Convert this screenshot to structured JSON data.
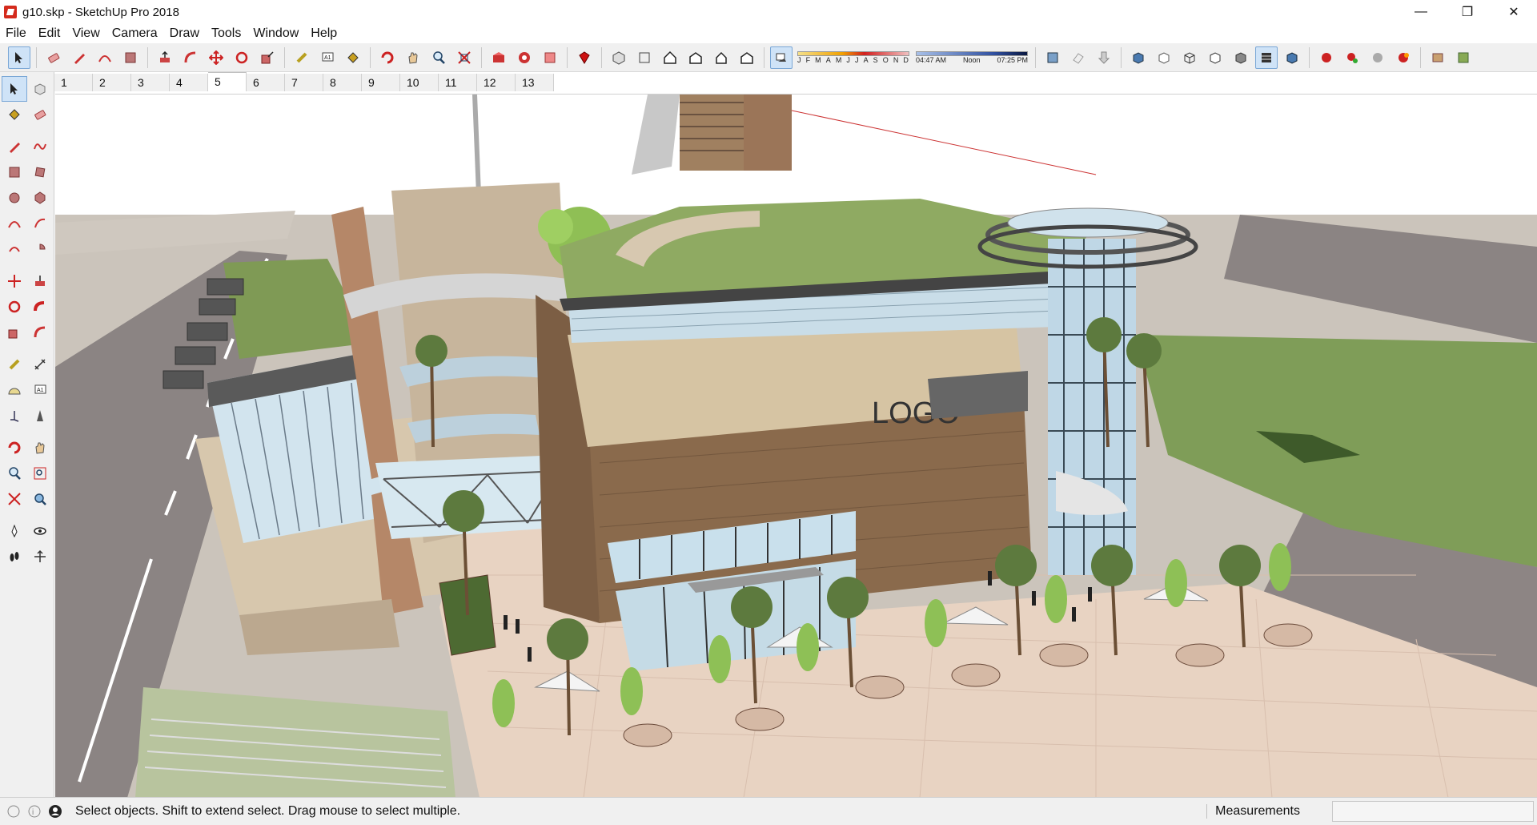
{
  "window": {
    "title": "g10.skp - SketchUp Pro 2018",
    "minimize_glyph": "—",
    "restore_glyph": "❐",
    "close_glyph": "✕"
  },
  "menu": [
    "File",
    "Edit",
    "View",
    "Camera",
    "Draw",
    "Tools",
    "Window",
    "Help"
  ],
  "shadow_settings": {
    "months": [
      "J",
      "F",
      "M",
      "A",
      "M",
      "J",
      "J",
      "A",
      "S",
      "O",
      "N",
      "D"
    ],
    "time_start": "04:47 AM",
    "time_mid": "Noon",
    "time_end": "07:25 PM"
  },
  "scenes": {
    "tabs": [
      "1",
      "2",
      "3",
      "4",
      "5",
      "6",
      "7",
      "8",
      "9",
      "10",
      "11",
      "12",
      "13"
    ],
    "active_index": 4
  },
  "viewport": {
    "sign_text": "LOGO",
    "colors": {
      "ground": "#ccc5bc",
      "road": "#8b8483",
      "lawn": "#7f9d58",
      "roof_green": "#8faa62",
      "brown_cladding": "#8a6a4c",
      "beige_band": "#d6c4a3",
      "glass": "#c9dfe9",
      "plaza_tiles": "#e8d2c2",
      "sky": "#ffffff"
    }
  },
  "statusbar": {
    "message": "Select objects. Shift to extend select. Drag mouse to select multiple.",
    "measurements_label": "Measurements",
    "measurements_value": ""
  }
}
